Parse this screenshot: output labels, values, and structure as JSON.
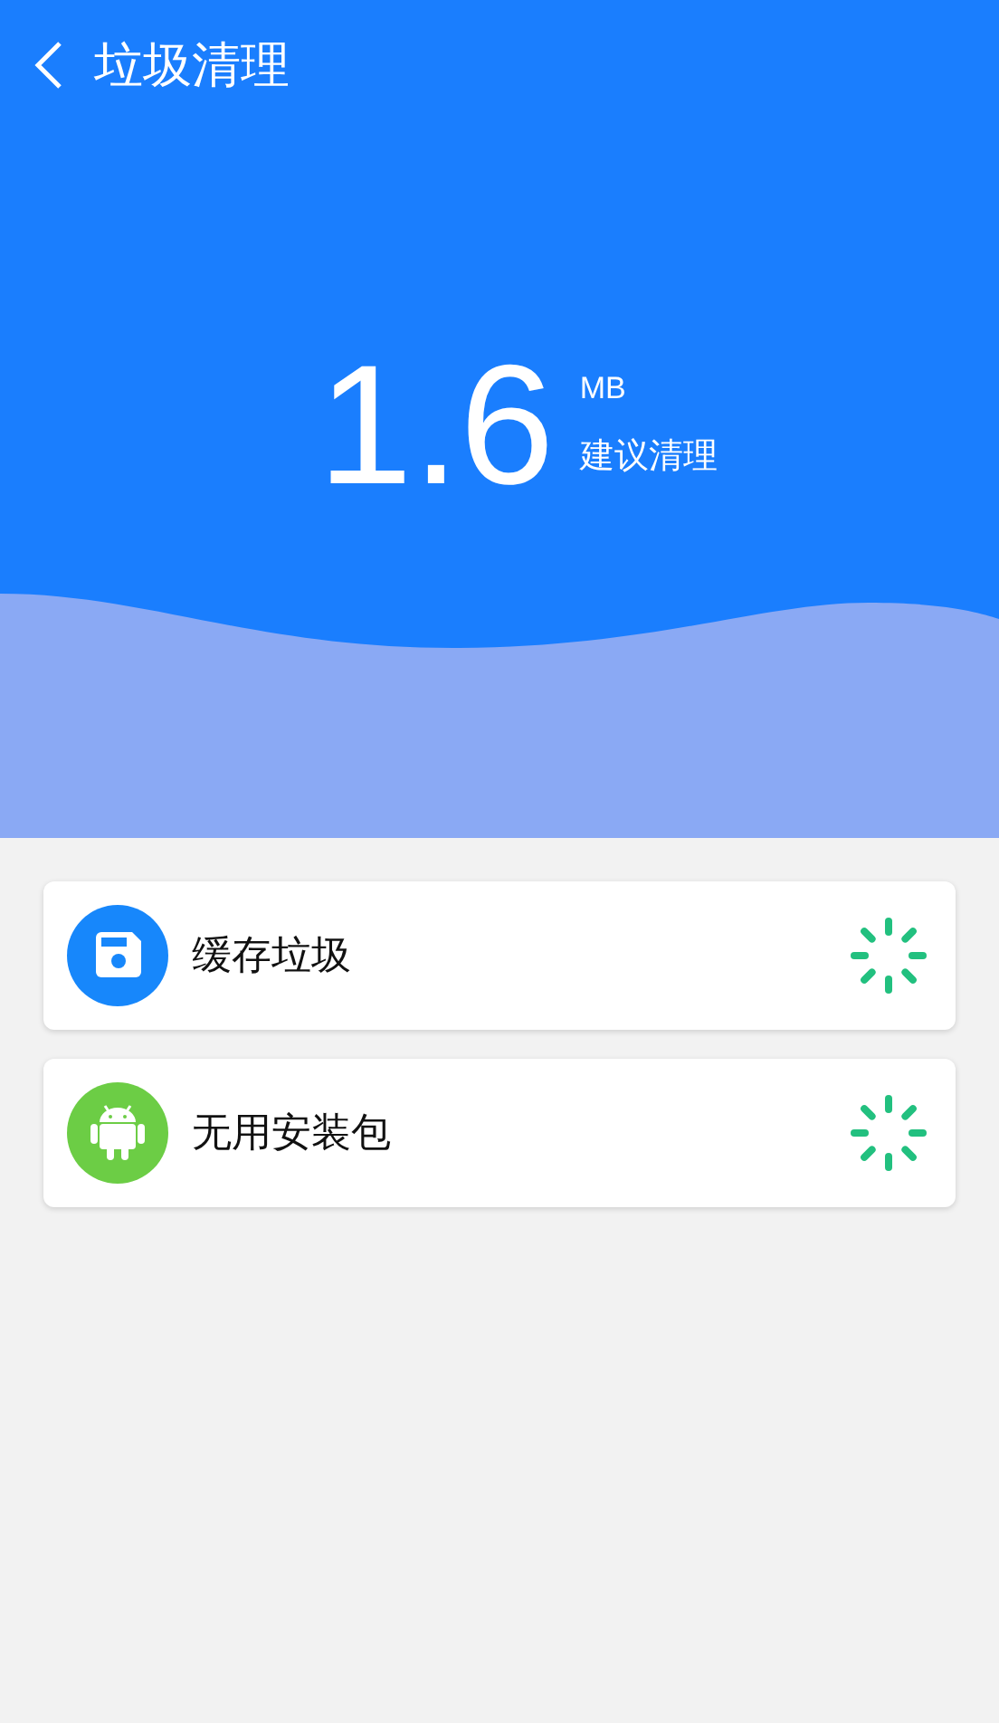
{
  "top_bar": {
    "title": "垃圾清理"
  },
  "summary": {
    "size": "1.6",
    "unit": "MB",
    "advice": "建议清理"
  },
  "items": [
    {
      "label": "缓存垃圾",
      "kind": "cache",
      "scanning": true
    },
    {
      "label": "无用安装包",
      "kind": "apk",
      "scanning": true
    }
  ]
}
